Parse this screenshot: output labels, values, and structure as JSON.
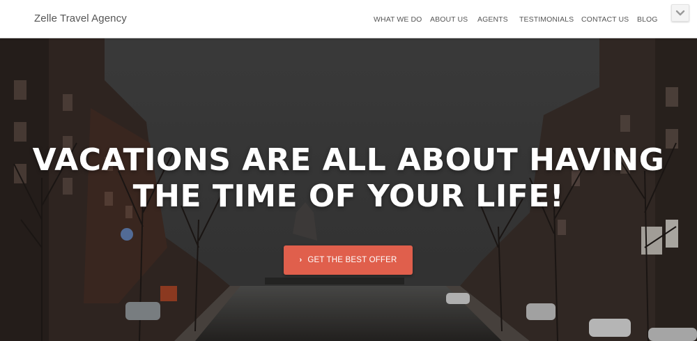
{
  "header": {
    "brand": "Zelle Travel Agency",
    "nav": [
      {
        "label": "WHAT WE DO",
        "name": "nav-link-what-we-do"
      },
      {
        "label": "ABOUT US",
        "name": "nav-link-about-us"
      },
      {
        "label": "AGENTS",
        "name": "nav-link-agents"
      },
      {
        "label": "TESTIMONIALS",
        "name": "nav-link-testimonials"
      },
      {
        "label": "CONTACT US",
        "name": "nav-link-contact-us"
      },
      {
        "label": "BLOG",
        "name": "nav-link-blog"
      }
    ],
    "toggle_icon": "chevron-down-icon"
  },
  "hero": {
    "title_line1": "VACATIONS ARE ALL ABOUT HAVING",
    "title_line2": "THE TIME OF YOUR LIFE!",
    "cta_label": "GET THE BEST OFFER",
    "cta_icon": "chevron-right-icon",
    "background_image": "Amsterdam canal street scene with trees and buildings"
  },
  "colors": {
    "accent": "#e05f4c",
    "nav_text": "#555555",
    "header_bg": "#ffffff",
    "hero_text": "#ffffff"
  }
}
